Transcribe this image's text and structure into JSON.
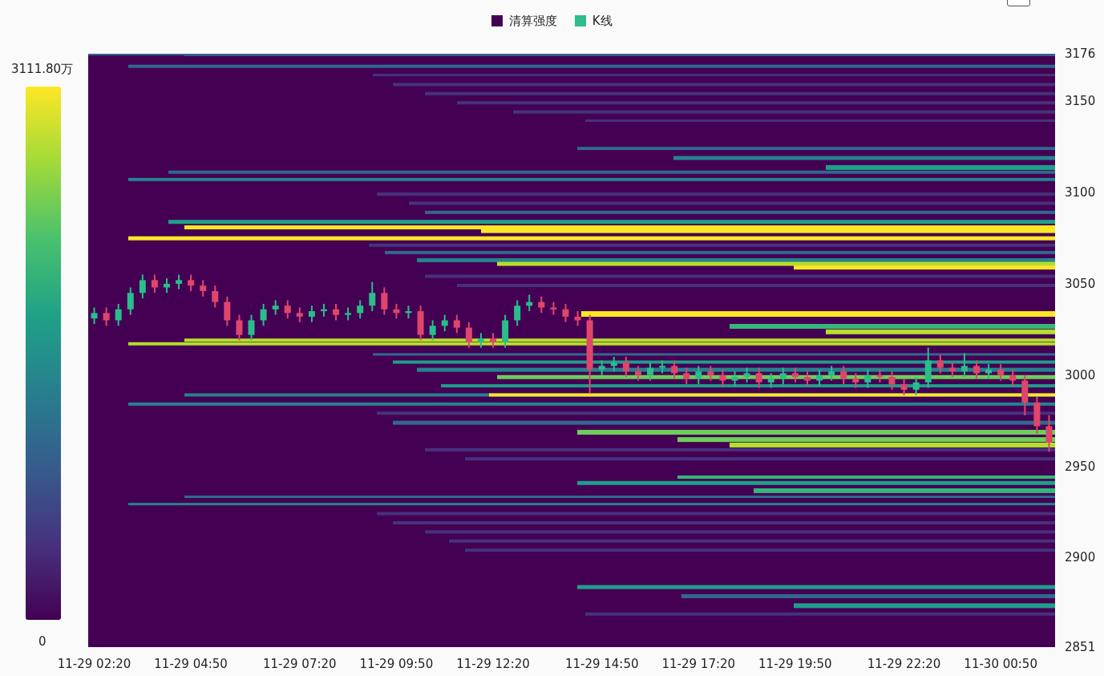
{
  "legend": [
    {
      "label": "清算强度",
      "color": "#440154"
    },
    {
      "label": "K线",
      "color": "#2bbd8b"
    }
  ],
  "corner_checkbox": {
    "checked": false
  },
  "colorbar": {
    "max_label": "3111.80万",
    "min_label": "0"
  },
  "chart_data": {
    "type": "candlestick",
    "ylim": [
      2851,
      3176
    ],
    "yticks": [
      3176,
      3150,
      3100,
      3050,
      3000,
      2950,
      2900,
      2851
    ],
    "categories": [
      "11-29 02:20",
      null,
      null,
      null,
      null,
      null,
      null,
      null,
      "11-29 04:50",
      null,
      null,
      null,
      null,
      null,
      null,
      null,
      null,
      "11-29 07:20",
      null,
      null,
      null,
      null,
      null,
      null,
      null,
      "11-29 09:50",
      null,
      null,
      null,
      null,
      null,
      null,
      null,
      "11-29 12:20",
      null,
      null,
      null,
      null,
      null,
      null,
      null,
      null,
      "11-29 14:50",
      null,
      null,
      null,
      null,
      null,
      null,
      null,
      "11-29 17:20",
      null,
      null,
      null,
      null,
      null,
      null,
      null,
      "11-29 19:50",
      null,
      null,
      null,
      null,
      null,
      null,
      null,
      null,
      "11-29 22:20",
      null,
      null,
      null,
      null,
      null,
      null,
      null,
      "11-30 00:50",
      null,
      null,
      null,
      null
    ],
    "ohlc": [
      [
        3031,
        3037,
        3028,
        3034
      ],
      [
        3034,
        3037,
        3027,
        3030
      ],
      [
        3030,
        3039,
        3027,
        3036
      ],
      [
        3036,
        3048,
        3033,
        3045
      ],
      [
        3045,
        3055,
        3042,
        3052
      ],
      [
        3052,
        3055,
        3045,
        3048
      ],
      [
        3048,
        3053,
        3045,
        3050
      ],
      [
        3050,
        3055,
        3047,
        3052
      ],
      [
        3052,
        3055,
        3046,
        3049
      ],
      [
        3049,
        3052,
        3043,
        3046
      ],
      [
        3046,
        3049,
        3037,
        3040
      ],
      [
        3040,
        3043,
        3027,
        3030
      ],
      [
        3030,
        3033,
        3019,
        3022
      ],
      [
        3022,
        3033,
        3019,
        3030
      ],
      [
        3030,
        3039,
        3027,
        3036
      ],
      [
        3036,
        3041,
        3033,
        3038
      ],
      [
        3038,
        3041,
        3031,
        3034
      ],
      [
        3034,
        3037,
        3029,
        3032
      ],
      [
        3032,
        3038,
        3029,
        3035
      ],
      [
        3035,
        3039,
        3032,
        3036
      ],
      [
        3036,
        3039,
        3030,
        3033
      ],
      [
        3033,
        3037,
        3030,
        3034
      ],
      [
        3034,
        3041,
        3031,
        3038
      ],
      [
        3038,
        3051,
        3035,
        3045
      ],
      [
        3045,
        3048,
        3033,
        3036
      ],
      [
        3036,
        3039,
        3031,
        3034
      ],
      [
        3034,
        3038,
        3031,
        3035
      ],
      [
        3035,
        3038,
        3019,
        3022
      ],
      [
        3022,
        3030,
        3019,
        3027
      ],
      [
        3027,
        3033,
        3024,
        3030
      ],
      [
        3030,
        3033,
        3023,
        3026
      ],
      [
        3026,
        3029,
        3015,
        3018
      ],
      [
        3018,
        3023,
        3015,
        3020
      ],
      [
        3020,
        3023,
        3015,
        3018
      ],
      [
        3018,
        3033,
        3015,
        3030
      ],
      [
        3030,
        3041,
        3027,
        3038
      ],
      [
        3038,
        3044,
        3035,
        3040
      ],
      [
        3040,
        3043,
        3034,
        3037
      ],
      [
        3037,
        3040,
        3033,
        3036
      ],
      [
        3036,
        3039,
        3029,
        3032
      ],
      [
        3032,
        3035,
        3027,
        3030
      ],
      [
        3030,
        3033,
        2990,
        3003
      ],
      [
        3003,
        3008,
        3000,
        3005
      ],
      [
        3005,
        3010,
        3002,
        3007
      ],
      [
        3007,
        3010,
        2999,
        3002
      ],
      [
        3002,
        3005,
        2997,
        3000
      ],
      [
        3000,
        3007,
        2997,
        3004
      ],
      [
        3004,
        3008,
        3001,
        3005
      ],
      [
        3005,
        3008,
        2998,
        3001
      ],
      [
        3001,
        3004,
        2995,
        2998
      ],
      [
        2998,
        3005,
        2995,
        3002
      ],
      [
        3002,
        3005,
        2997,
        3000
      ],
      [
        3000,
        3003,
        2994,
        2997
      ],
      [
        2997,
        3002,
        2994,
        2999
      ],
      [
        2999,
        3004,
        2996,
        3001
      ],
      [
        3001,
        3004,
        2993,
        2996
      ],
      [
        2996,
        3001,
        2993,
        2998
      ],
      [
        2998,
        3004,
        2995,
        3001
      ],
      [
        3001,
        3004,
        2996,
        2999
      ],
      [
        2999,
        3002,
        2994,
        2997
      ],
      [
        2997,
        3003,
        2994,
        3000
      ],
      [
        3000,
        3005,
        2997,
        3002
      ],
      [
        3002,
        3005,
        2995,
        2998
      ],
      [
        2998,
        3001,
        2993,
        2996
      ],
      [
        2996,
        3003,
        2993,
        3000
      ],
      [
        3000,
        3003,
        2996,
        2999
      ],
      [
        2999,
        3002,
        2992,
        2995
      ],
      [
        2995,
        2998,
        2989,
        2992
      ],
      [
        2992,
        2999,
        2989,
        2996
      ],
      [
        2996,
        3015,
        2993,
        3008
      ],
      [
        3008,
        3011,
        3001,
        3004
      ],
      [
        3004,
        3007,
        2999,
        3002
      ],
      [
        3002,
        3012,
        2999,
        3005
      ],
      [
        3005,
        3008,
        2998,
        3001
      ],
      [
        3001,
        3006,
        2998,
        3003
      ],
      [
        3003,
        3006,
        2997,
        3000
      ],
      [
        3000,
        3003,
        2994,
        2997
      ],
      [
        2997,
        3000,
        2978,
        2985
      ],
      [
        2985,
        2988,
        2968,
        2972
      ],
      [
        2972,
        2978,
        2958,
        2963
      ]
    ]
  }
}
